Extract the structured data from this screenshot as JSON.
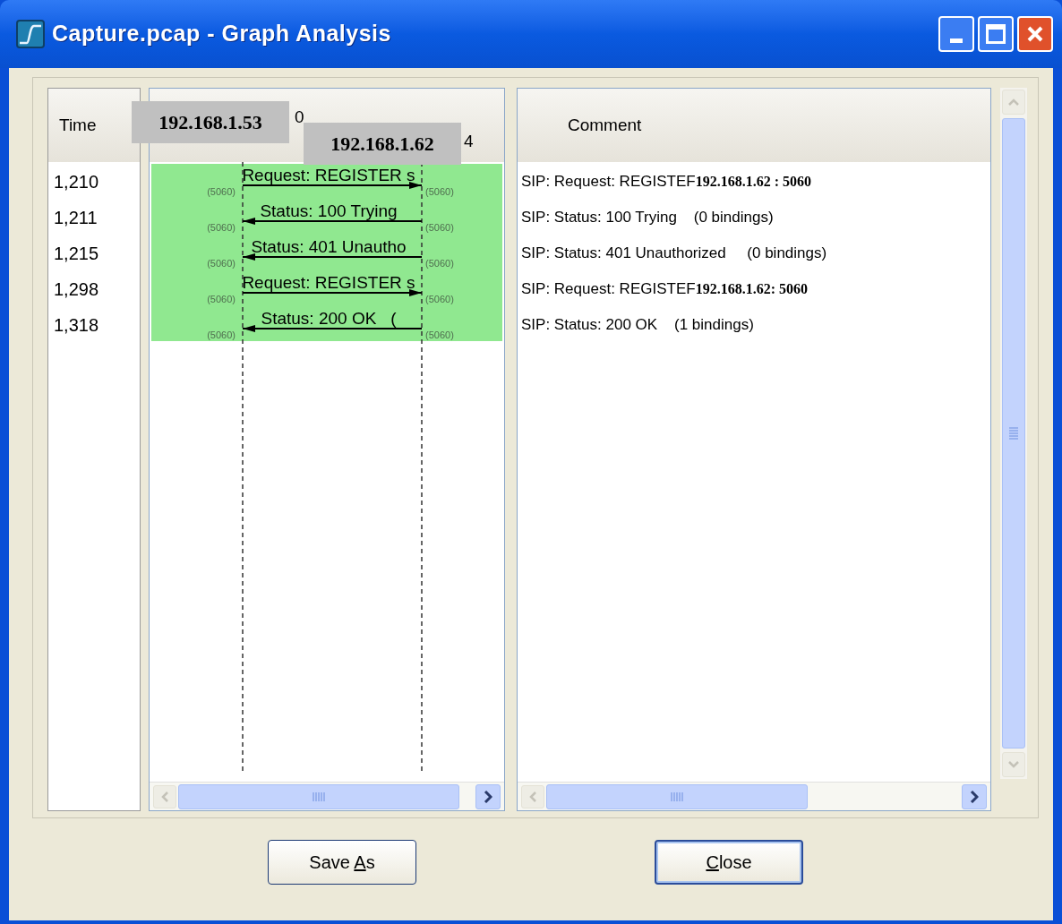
{
  "window": {
    "title": "Capture.pcap - Graph Analysis"
  },
  "time_header": "Time",
  "hosts": [
    {
      "header_fragment": "0",
      "overlay_label": "192.168.1.53"
    },
    {
      "header_fragment": "4",
      "overlay_label": "192.168.1.62"
    }
  ],
  "comment_header": "Comment",
  "rows": [
    {
      "time": "1,210",
      "arrow_label": "Request: REGISTER s",
      "kind": "request",
      "left_port": "(5060)",
      "right_port": "(5060)",
      "comment": "SIP: Request: REGISTEF",
      "comment_overlay": "192.168.1.62 : 5060"
    },
    {
      "time": "1,211",
      "arrow_label": "Status: 100 Trying",
      "kind": "response",
      "left_port": "(5060)",
      "right_port": "(5060)",
      "comment": "SIP: Status: 100 Trying    (0 bindings)"
    },
    {
      "time": "1,215",
      "arrow_label": "Status: 401 Unautho",
      "kind": "response",
      "left_port": "(5060)",
      "right_port": "(5060)",
      "comment": "SIP: Status: 401 Unauthorized     (0 bindings)"
    },
    {
      "time": "1,298",
      "arrow_label": "Request: REGISTER s",
      "kind": "request",
      "left_port": "(5060)",
      "right_port": "(5060)",
      "comment": "SIP: Request: REGISTEF",
      "comment_overlay": "192.168.1.62: 5060"
    },
    {
      "time": "1,318",
      "arrow_label": "Status: 200 OK   (",
      "kind": "response",
      "left_port": "(5060)",
      "right_port": "(5060)",
      "comment": "SIP: Status: 200 OK    (1 bindings)"
    }
  ],
  "buttons": [
    {
      "before": "Save ",
      "mnemonic": "A",
      "after": "s",
      "default": false
    },
    {
      "mnemonic": "C",
      "after": "lose",
      "default": true
    }
  ]
}
